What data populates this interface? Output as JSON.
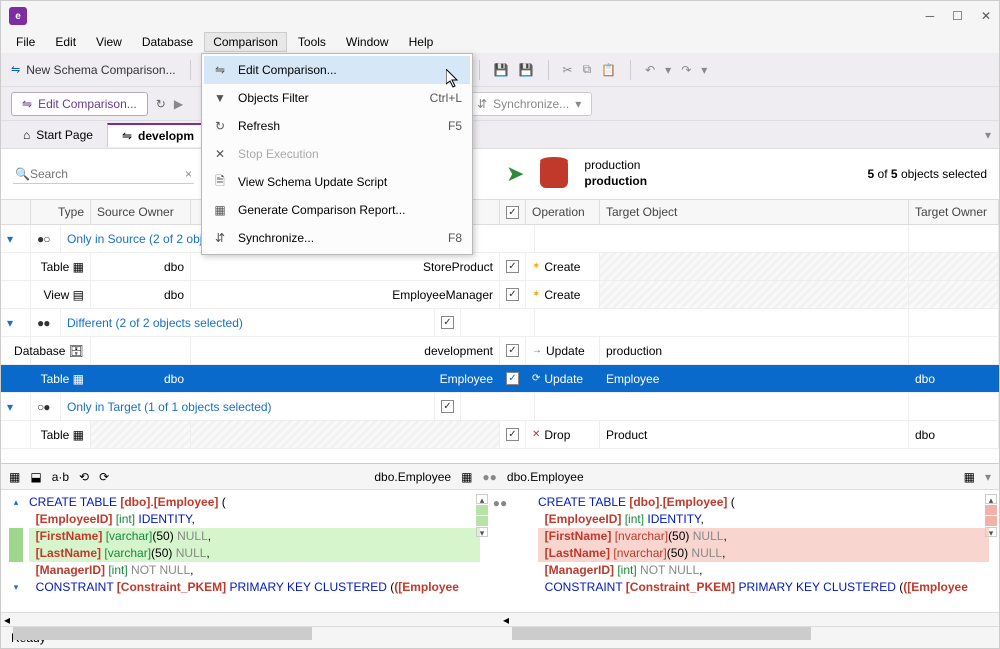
{
  "menu": {
    "items": [
      "File",
      "Edit",
      "View",
      "Database",
      "Comparison",
      "Tools",
      "Window",
      "Help"
    ]
  },
  "dropdown": [
    {
      "icon": "⇋",
      "label": "Edit Comparison...",
      "shortcut": "",
      "hover": true
    },
    {
      "icon": "▼",
      "label": "Objects Filter",
      "shortcut": "Ctrl+L"
    },
    {
      "icon": "↻",
      "label": "Refresh",
      "shortcut": "F5"
    },
    {
      "icon": "✕",
      "label": "Stop Execution",
      "shortcut": "",
      "disabled": true
    },
    {
      "icon": "🗎",
      "label": "View Schema Update Script",
      "shortcut": ""
    },
    {
      "icon": "▦",
      "label": "Generate Comparison Report...",
      "shortcut": ""
    },
    {
      "icon": "⇵",
      "label": "Synchronize...",
      "shortcut": "F8"
    }
  ],
  "toolbar": {
    "newcomp": "New Schema Comparison...",
    "save": "💾",
    "save2": "💾",
    "cut": "✂",
    "copy": "⧉",
    "paste": "📋",
    "undo": "↶",
    "redo": "↷"
  },
  "tabs": {
    "main": "Edit Comparison...",
    "refresh": "↻",
    "stop": "✕",
    "scroll": "↔",
    "sync": "Synchronize..."
  },
  "tabs2": {
    "start": "Start Page",
    "dev": "developm"
  },
  "search": {
    "placeholder": "Search"
  },
  "target": {
    "name": "production",
    "db": "production"
  },
  "selcount": {
    "a": "5",
    "b": "5",
    "t": "objects selected"
  },
  "headers": {
    "type": "Type",
    "sowner": "Source Owner",
    "chk": "✓",
    "op": "Operation",
    "tobj": "Target Object",
    "towner": "Target Owner"
  },
  "groups": {
    "onlysrc": "Only in Source (2 of 2 objects selected)",
    "diff": "Different (2 of 2 objects selected)",
    "onlytgt": "Only in Target (1 of 1 objects selected)"
  },
  "rows": {
    "r1": {
      "type": "Table",
      "owner": "dbo",
      "obj": "StoreProduct",
      "op": "Create"
    },
    "r2": {
      "type": "View",
      "owner": "dbo",
      "obj": "EmployeeManager",
      "op": "Create"
    },
    "r3": {
      "type": "Database",
      "owner": "",
      "obj": "development",
      "op": "Update",
      "tgt": "production"
    },
    "r4": {
      "type": "Table",
      "owner": "dbo",
      "obj": "Employee",
      "op": "Update",
      "tgt": "Employee",
      "towner": "dbo"
    },
    "r5": {
      "type": "Table",
      "owner": "",
      "obj": "",
      "op": "Drop",
      "tgt": "Product",
      "towner": "dbo"
    }
  },
  "codehdr": {
    "left": "dbo.Employee",
    "right": "dbo.Employee"
  },
  "code": {
    "l1a": "CREATE TABLE ",
    "l1b": "[dbo]",
    "l1c": ".",
    "l1d": "[Employee]",
    "l1e": " (",
    "l2a": "[EmployeeID]",
    "l2b": " [int] ",
    "l2c": "IDENTITY",
    "l3a": "[FirstName]",
    "l3bL": " [varchar]",
    "l3bR": " [nvarchar]",
    "l3c": "(50) ",
    "l3d": "NULL",
    "l4a": "[LastName]",
    "l4bL": " [varchar]",
    "l4bR": " [nvarchar]",
    "l4c": "(50) ",
    "l4d": "NULL",
    "l5a": "[ManagerID]",
    "l5b": " [int] ",
    "l5c": "NOT NULL",
    "l6a": "CONSTRAINT ",
    "l6b": "[Constraint_PKEM]",
    "l6c": " PRIMARY KEY CLUSTERED ",
    "l6d": "([Employee"
  },
  "status": "Ready"
}
